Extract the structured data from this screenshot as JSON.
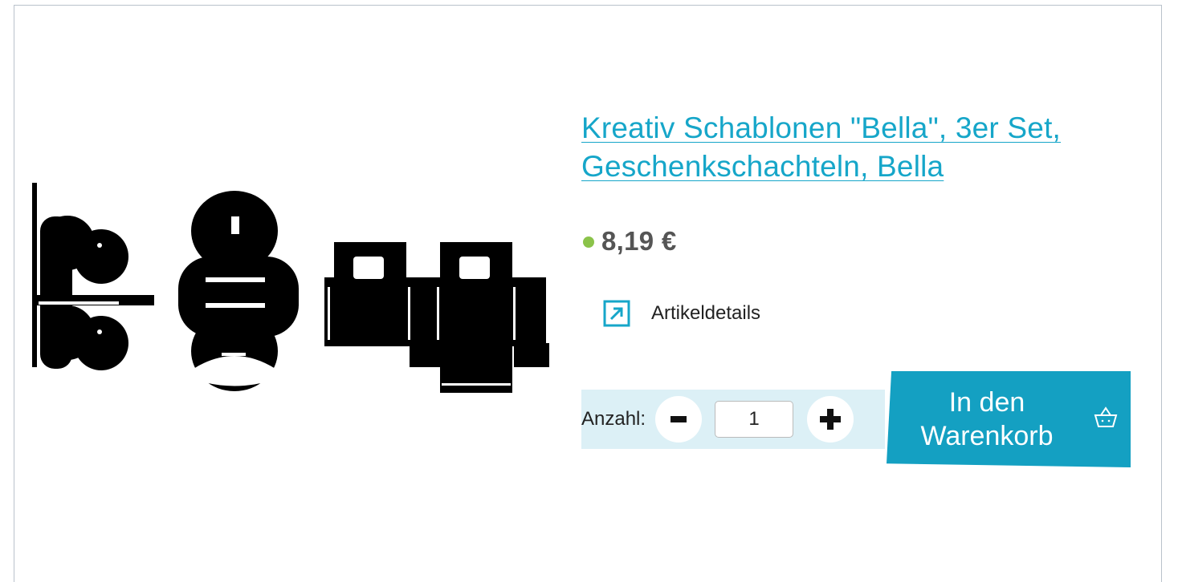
{
  "product": {
    "title": "Kreativ Schablonen \"Bella\", 3er Set, Geschenkschachteln, Bella",
    "price": "8,19 €",
    "stock_color": "#8bc34a"
  },
  "details": {
    "label": "Artikeldetails",
    "icon": "external-link-icon"
  },
  "quantity": {
    "label": "Anzahl:",
    "value": "1",
    "minus_icon": "minus-icon",
    "plus_icon": "plus-icon"
  },
  "cart": {
    "label": "In den Warenkorb",
    "icon": "basket-icon"
  },
  "colors": {
    "accent": "#14a0c2",
    "link": "#16a6c9",
    "qty_bg": "#dcf0f6",
    "price": "#555555"
  }
}
